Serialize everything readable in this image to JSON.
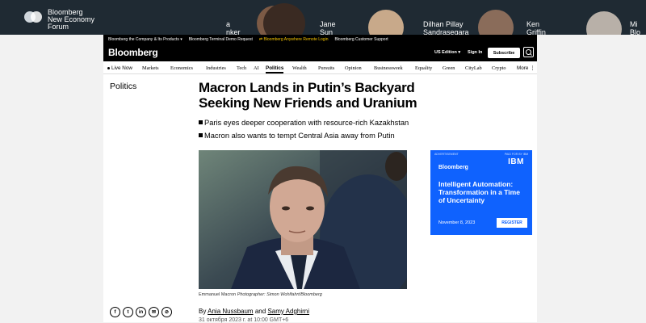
{
  "forum": {
    "name_line1": "Bloomberg",
    "name_line2": "New Economy",
    "name_line3": "Forum",
    "speakers": [
      {
        "line1": "a",
        "line2": "nker"
      },
      {
        "line1": "Jane",
        "line2": "Sun"
      },
      {
        "line1": "Dilhan Pillay",
        "line2": "Sandrasegara"
      },
      {
        "line1": "Ken",
        "line2": "Griffin"
      },
      {
        "line1": "Mi",
        "line2": "Blo"
      }
    ]
  },
  "toplinks": [
    "Bloomberg the Company & Its Products ▾",
    "Bloomberg Terminal Demo Request",
    "Bloomberg Anywhere Remote Login",
    "Bloomberg Customer Support"
  ],
  "header": {
    "brand": "Bloomberg",
    "edition": "US Edition ▾",
    "signin": "Sign In",
    "subscribe": "Subscribe"
  },
  "nav": {
    "live": "Live Now",
    "items": [
      "Markets",
      "Economics",
      "Industries",
      "Tech",
      "AI",
      "Politics",
      "Wealth",
      "Pursuits",
      "Opinion",
      "Businessweek",
      "Equality",
      "Green",
      "CityLab",
      "Crypto",
      "More ⋮"
    ]
  },
  "article": {
    "section": "Politics",
    "headline": "Macron Lands in Putin’s Backyard Seeking New Friends and Uranium",
    "bullets": [
      "Paris eyes deeper cooperation with resource-rich Kazakhstan",
      "Macron also wants to tempt Central Asia away from Putin"
    ],
    "caption_name": "Emmanuel Macron",
    "caption_credit": "Photographer: Simon Wohlfahrt/Bloomberg",
    "byline_prefix": "By",
    "author1": "Ania Nussbaum",
    "byline_and": "and",
    "author2": "Samy Adghirni",
    "date": "31 октября 2023 г. at 10:00 GMT+6"
  },
  "share": [
    "f",
    "t",
    "in",
    "✉",
    "⊘"
  ],
  "ad": {
    "tag_left": "ADVERTISEMENT",
    "tag_right": "PAID FOR BY IBM",
    "logo": "IBM",
    "brand": "Bloomberg",
    "title": "Intelligent Automation: Transformation in a Time of Uncertainty",
    "date": "November 8, 2023",
    "button": "REGISTER"
  },
  "colors": {
    "ad_blue": "#0f62fe",
    "banner": "#1f2a33",
    "accent_gold": "#f5c400"
  }
}
